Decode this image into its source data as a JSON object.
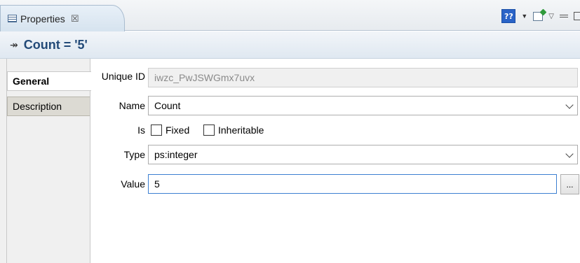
{
  "view": {
    "tab_title": "Properties",
    "tab_close_glyph": "☒",
    "help_label": "??"
  },
  "header": {
    "icon_glyph": "↠",
    "title": "Count = '5'"
  },
  "side_tabs": [
    {
      "label": "General"
    },
    {
      "label": "Description"
    }
  ],
  "form": {
    "unique_id": {
      "label": "Unique ID",
      "value": "iwzc_PwJSWGmx7uvx"
    },
    "name": {
      "label": "Name",
      "value": "Count"
    },
    "is": {
      "label": "Is",
      "fixed": {
        "label": "Fixed",
        "checked": false
      },
      "inheritable": {
        "label": "Inheritable",
        "checked": false
      }
    },
    "type": {
      "label": "Type",
      "value": "ps:integer"
    },
    "value": {
      "label": "Value",
      "value": "5",
      "browse_label": "..."
    }
  }
}
